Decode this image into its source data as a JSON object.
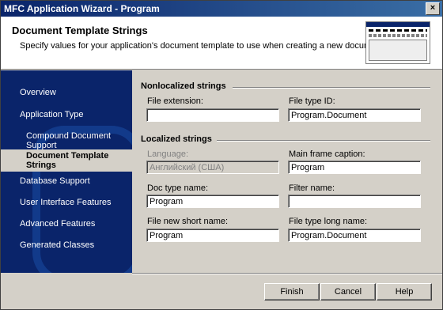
{
  "window": {
    "title": "MFC Application Wizard - Program",
    "close_label": "×"
  },
  "header": {
    "title": "Document Template Strings",
    "description": "Specify values for your application's document template to use when creating a new document."
  },
  "sidebar": {
    "items": [
      {
        "label": "Overview"
      },
      {
        "label": "Application Type"
      },
      {
        "label": "Compound Document Support"
      },
      {
        "label": "Document Template Strings",
        "line1": "Document Template",
        "line2": "Strings",
        "active": true
      },
      {
        "label": "Database Support"
      },
      {
        "label": "User Interface Features"
      },
      {
        "label": "Advanced Features"
      },
      {
        "label": "Generated Classes"
      }
    ]
  },
  "nonlocalized": {
    "heading": "Nonlocalized strings",
    "file_extension": {
      "label": "File extension:",
      "value": ""
    },
    "file_type_id": {
      "label": "File type ID:",
      "value": "Program.Document"
    }
  },
  "localized": {
    "heading": "Localized strings",
    "language": {
      "label": "Language:",
      "value": "Английский (США)"
    },
    "main_frame_caption": {
      "label": "Main frame caption:",
      "value": "Program"
    },
    "doc_type_name": {
      "label": "Doc type name:",
      "value": "Program"
    },
    "filter_name": {
      "label": "Filter name:",
      "value": ""
    },
    "file_new_short_name": {
      "label": "File new short name:",
      "value": "Program"
    },
    "file_type_long_name": {
      "label": "File type long name:",
      "value": "Program.Document"
    }
  },
  "buttons": {
    "finish": "Finish",
    "cancel": "Cancel",
    "help": "Help"
  }
}
